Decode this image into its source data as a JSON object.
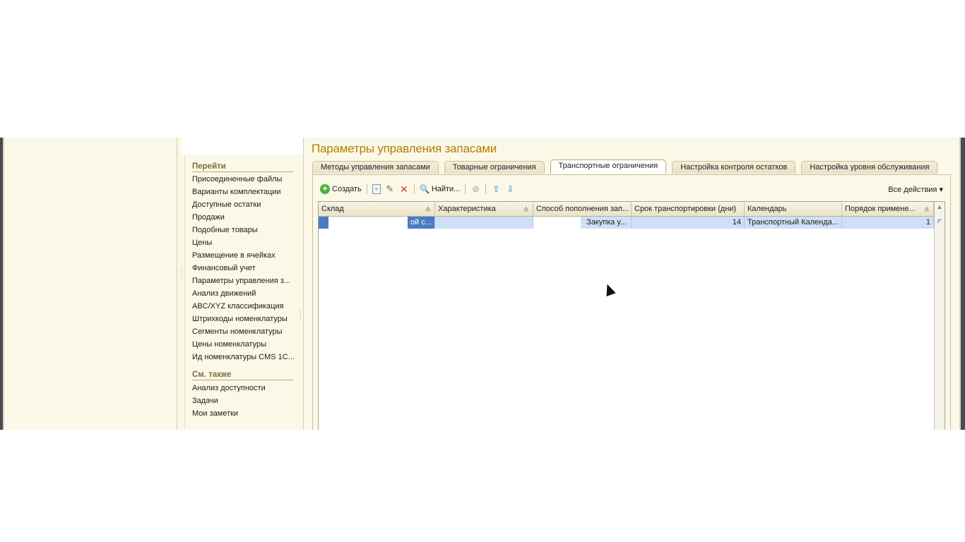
{
  "page": {
    "title": "Параметры управления запасами"
  },
  "nav": {
    "goto_heading": "Перейти",
    "goto_items": [
      "Присоединенные файлы",
      "Варианты комплектации",
      "Доступные остатки",
      "Продажи",
      "Подобные товары",
      "Цены",
      "Размещение в ячейках",
      "Финансовый учет",
      "Параметры управления з...",
      "Анализ движений",
      "ABC/XYZ классификация",
      "Штрихкоды номенклатуры",
      "Сегменты номенклатуры",
      "Цены номенклатуры",
      "Ид номенклатуры CMS 1C..."
    ],
    "see_also_heading": "См. также",
    "see_also_items": [
      "Анализ доступности",
      "Задачи",
      "Мои заметки"
    ]
  },
  "tabs": [
    "Методы управления запасами",
    "Товарные ограничения",
    "Транспортные ограничения",
    "Настройка контроля остатков",
    "Настройка уровня обслуживания"
  ],
  "active_tab": "Транспортные ограничения",
  "toolbar": {
    "create_label": "Создать",
    "find_label": "Найти...",
    "all_actions_label": "Все действия",
    "icons": [
      "plus-circle-icon",
      "copy-icon",
      "pencil-icon",
      "delete-icon",
      "search-icon",
      "cancel-search-icon",
      "arrow-up-icon",
      "arrow-down-icon"
    ]
  },
  "table": {
    "columns": [
      "Склад",
      "Характеристика",
      "Способ пополнения зап...",
      "Срок транспортировки (дни)",
      "Календарь",
      "Порядок примене..."
    ],
    "rows": [
      {
        "sklad": "ой с...",
        "harakteristika": "",
        "sposob": "Закупка у...",
        "srok": "14",
        "kalendar": "Транспортный Календа...",
        "poryadok": "1"
      }
    ]
  },
  "colors": {
    "title": "#b57e00",
    "panel_bg": "#fbf8e8",
    "row_selected": "#cfe0f6",
    "cell_focus": "#4a7cc4"
  }
}
